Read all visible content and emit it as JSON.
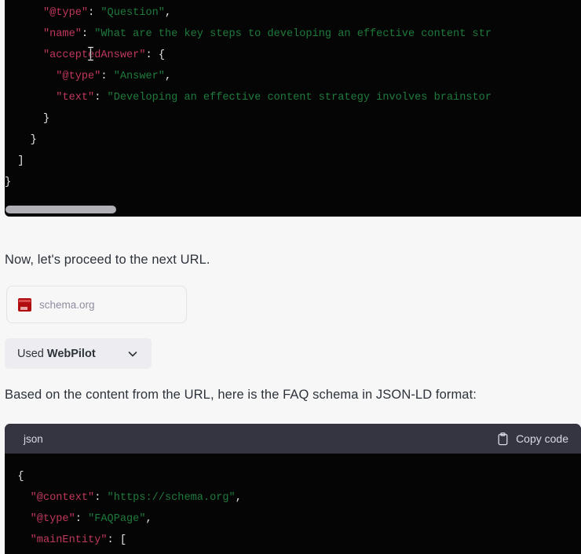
{
  "background_color": "#f7f7f8",
  "colors": {
    "code_background": "#050505",
    "code_header_background": "#343541",
    "json_key": "#c0385c",
    "json_string": "#1f7a3d",
    "json_punctuation": "#e8e8e8",
    "text": "#2d333a",
    "muted_text": "#8e8ea0",
    "button_background": "#ececf1",
    "scrollbar_thumb": "#b0b0b6",
    "favicon_red": "#b00d10"
  },
  "top_code_block": {
    "language": "json",
    "scrolled_horizontally": true,
    "lines": [
      {
        "indent": 6,
        "key": "\"@type\"",
        "sep": ": ",
        "value": "\"Question\"",
        "trail": ","
      },
      {
        "indent": 6,
        "key": "\"name\"",
        "sep": ": ",
        "value": "\"What are the key steps to developing an effective content str",
        "trail": ""
      },
      {
        "indent": 6,
        "key": "\"acceptedAnswer\"",
        "sep": ": ",
        "value": "",
        "trail": "{"
      },
      {
        "indent": 8,
        "key": "\"@type\"",
        "sep": ": ",
        "value": "\"Answer\"",
        "trail": ","
      },
      {
        "indent": 8,
        "key": "\"text\"",
        "sep": ": ",
        "value": "\"Developing an effective content strategy involves brainstor",
        "trail": ""
      },
      {
        "indent": 6,
        "key": "",
        "sep": "",
        "value": "",
        "trail": "}"
      },
      {
        "indent": 4,
        "key": "",
        "sep": "",
        "value": "",
        "trail": "}"
      },
      {
        "indent": 2,
        "key": "",
        "sep": "",
        "value": "",
        "trail": "]"
      },
      {
        "indent": 0,
        "key": "",
        "sep": "",
        "value": "",
        "trail": "}"
      }
    ],
    "line_texts": {
      "l1_key": "\"@type\"",
      "l1_colon": ": ",
      "l1_val": "\"Question\"",
      "l1_comma": ",",
      "l2_key": "\"name\"",
      "l2_colon": ": ",
      "l2_val": "\"What are the key steps to developing an effective content str",
      "l3_key": "\"acceptedAnswer\"",
      "l3_colon": ": ",
      "l3_brace": "{",
      "l4_key": "\"@type\"",
      "l4_colon": ": ",
      "l4_val": "\"Answer\"",
      "l4_comma": ",",
      "l5_key": "\"text\"",
      "l5_colon": ": ",
      "l5_val": "\"Developing an effective content strategy involves brainstor",
      "l6": "}",
      "l7": "}",
      "l8": "]",
      "l9": "}"
    }
  },
  "paragraph_1": "Now, let's proceed to the next URL.",
  "url_card": {
    "favicon_name": "schema-org-favicon",
    "label": "schema.org"
  },
  "used_tool_button": {
    "prefix": "Used ",
    "tool_name": "WebPilot",
    "chevron_icon": "chevron-down-icon"
  },
  "paragraph_2": "Based on the content from the URL, here is the FAQ schema in JSON-LD format:",
  "bottom_code_block": {
    "language_label": "json",
    "copy_label": "Copy code",
    "copy_icon": "clipboard-icon",
    "line_texts": {
      "l1_brace": "{",
      "l2_key": "\"@context\"",
      "l2_colon": ": ",
      "l2_val": "\"https://schema.org\"",
      "l2_comma": ",",
      "l3_key": "\"@type\"",
      "l3_colon": ": ",
      "l3_val": "\"FAQPage\"",
      "l3_comma": ",",
      "l4_key": "\"mainEntity\"",
      "l4_colon": ": ",
      "l4_bracket": "["
    }
  }
}
